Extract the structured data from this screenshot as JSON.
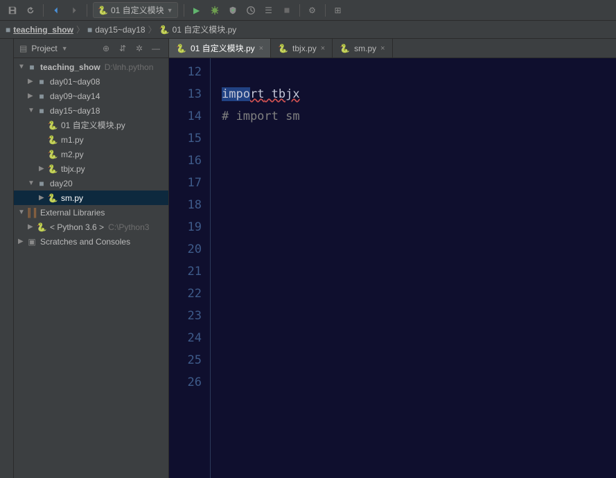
{
  "toolbar": {
    "run_config_label": "01 自定义模块",
    "run_config_arrow": "▼"
  },
  "breadcrumbs": {
    "items": [
      {
        "label": "teaching_show",
        "icon": "folder"
      },
      {
        "label": "day15~day18",
        "icon": "folder"
      },
      {
        "label": "01 自定义模块.py",
        "icon": "python"
      }
    ],
    "separator": "〉"
  },
  "sidebar": {
    "title": "Project",
    "dropdown": "▼"
  },
  "tree": {
    "root_name": "teaching_show",
    "root_path": "D:\\lnh.python",
    "day01": "day01~day08",
    "day09": "day09~day14",
    "day15": "day15~day18",
    "file01": "01 自定义模块.py",
    "filem1": "m1.py",
    "filem2": "m2.py",
    "filetbjx": "tbjx.py",
    "day20": "day20",
    "filesm": "sm.py",
    "extlib": "External Libraries",
    "python36": "< Python 3.6 >",
    "python36_path": "C:\\Python3",
    "scratches": "Scratches and Consoles"
  },
  "tabs": {
    "items": [
      {
        "label": "01 自定义模块.py",
        "active": true
      },
      {
        "label": "tbjx.py",
        "active": false
      },
      {
        "label": "sm.py",
        "active": false
      }
    ]
  },
  "editor": {
    "lines": [
      "12",
      "13",
      "14",
      "15",
      "16",
      "17",
      "18",
      "19",
      "20",
      "21",
      "22",
      "23",
      "24",
      "25",
      "26"
    ],
    "code": {
      "l13_sel": "impo",
      "l13_rest1": "rt",
      "l13_rest2": " tbjx",
      "l14": "# import sm"
    }
  }
}
